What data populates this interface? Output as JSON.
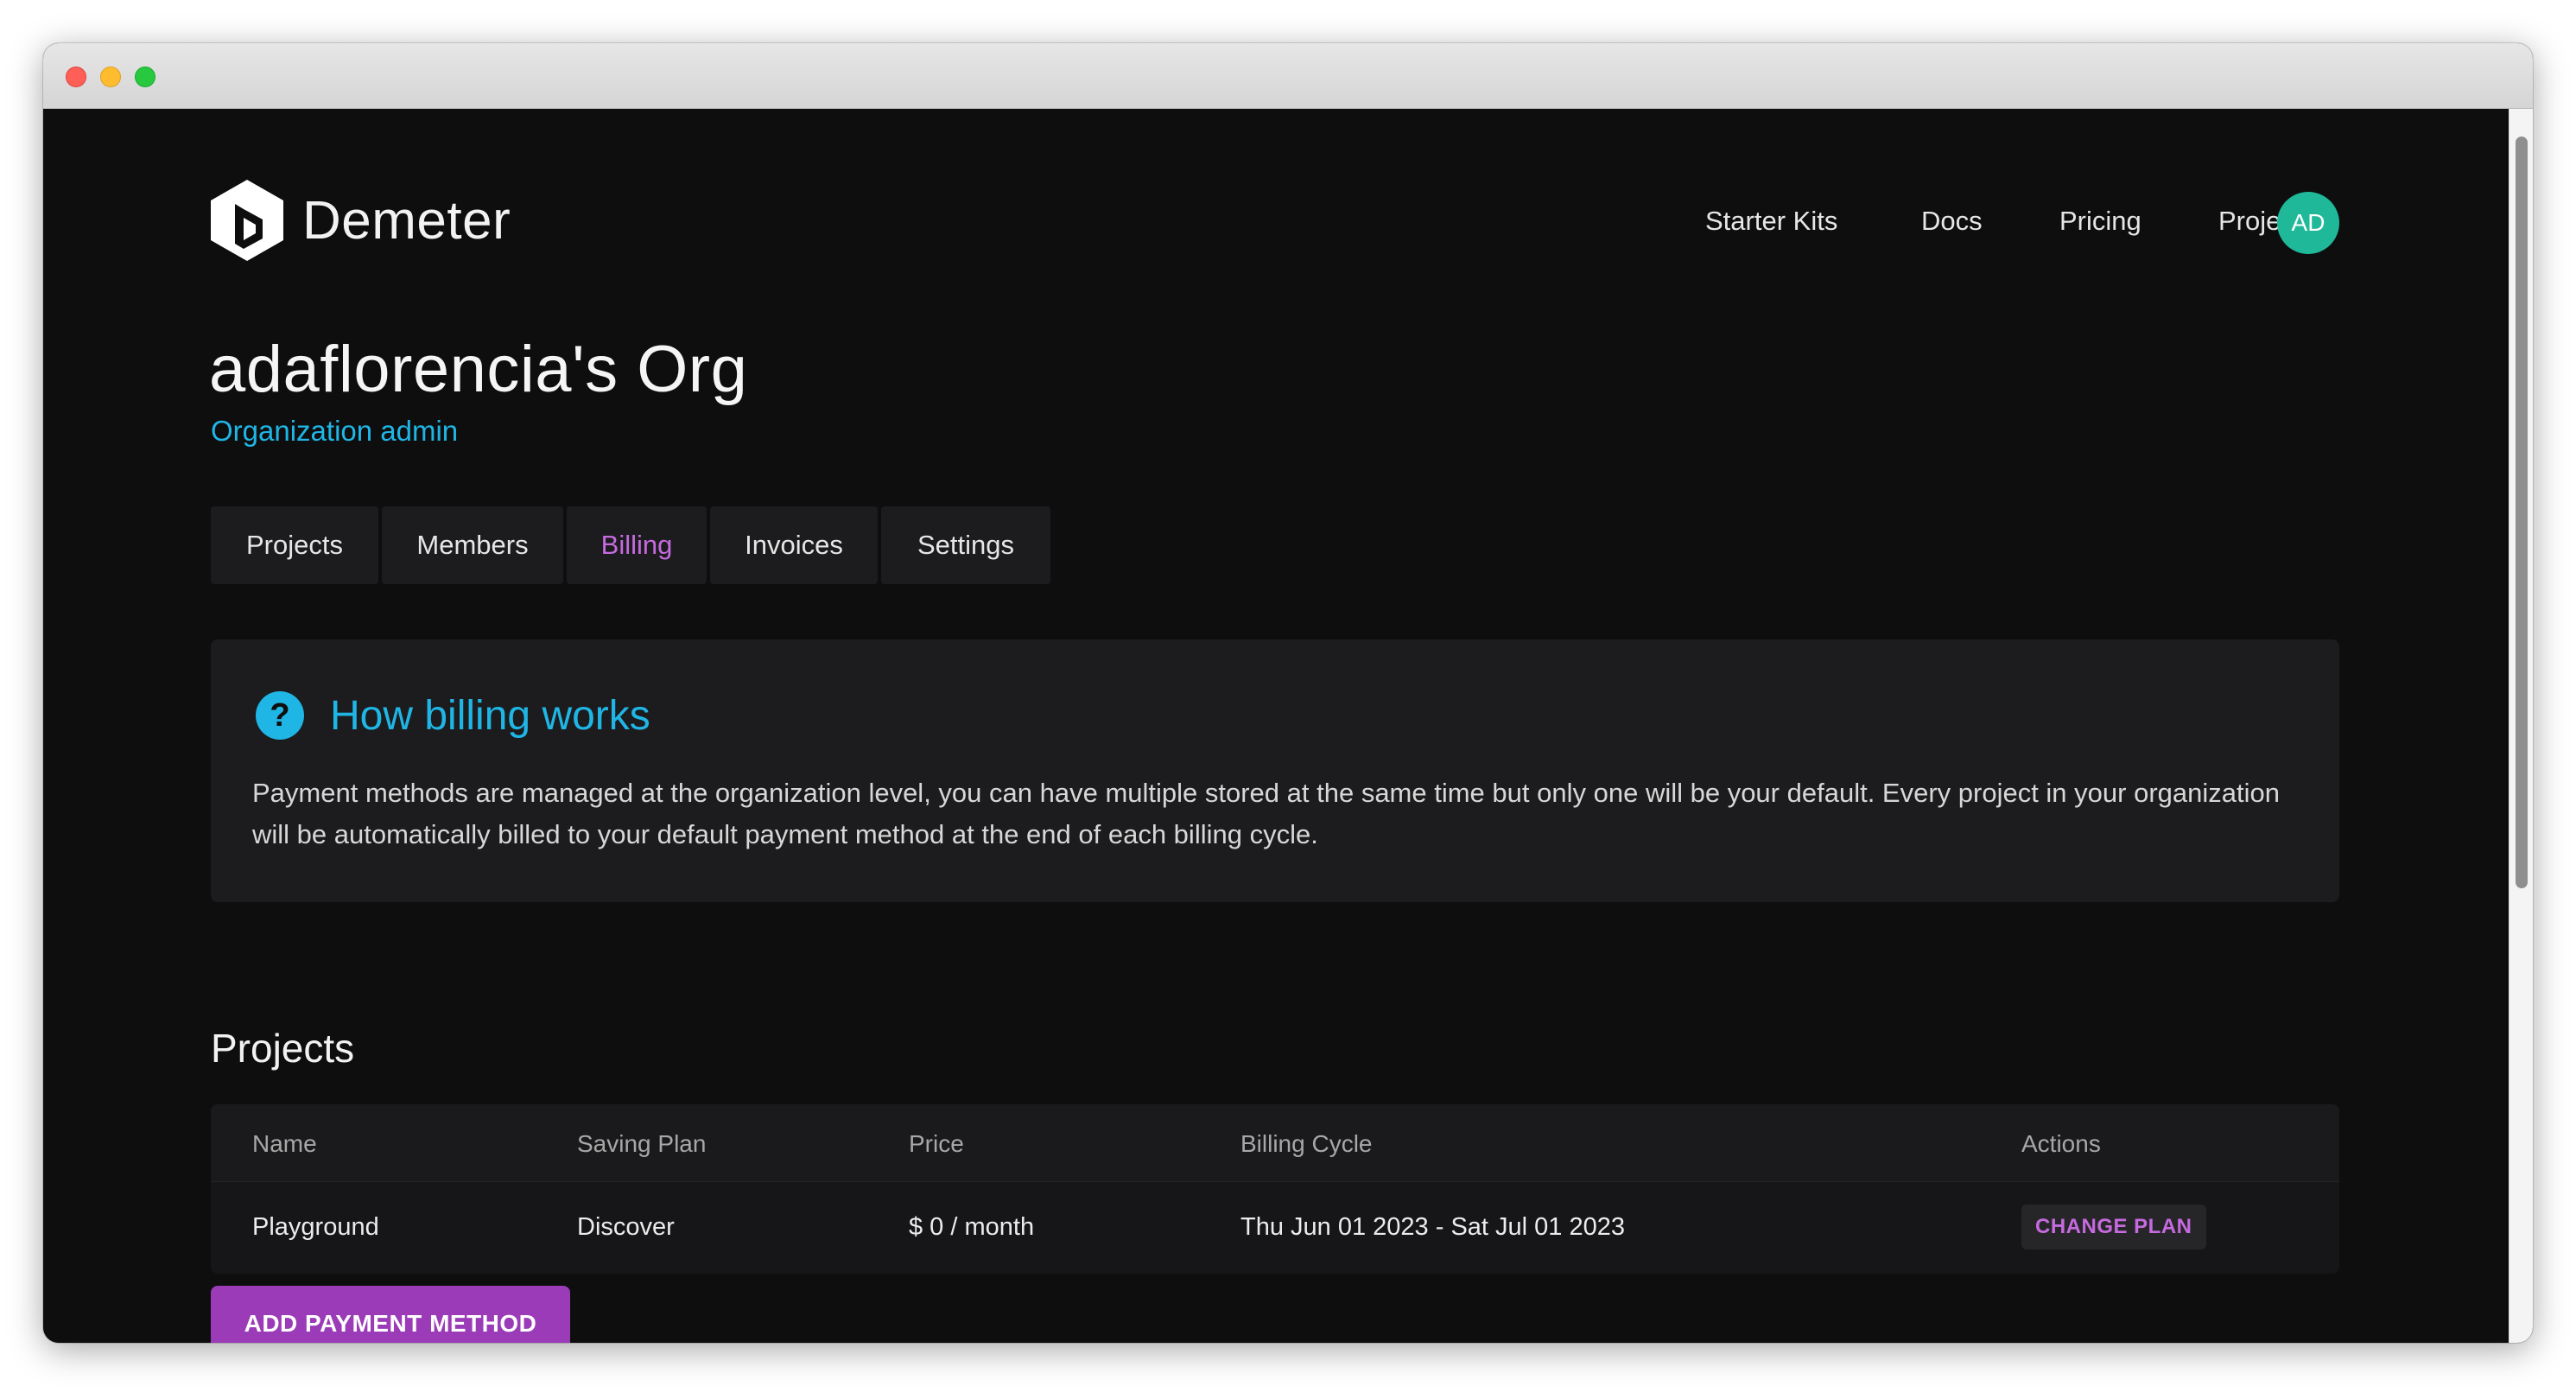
{
  "brand": {
    "name": "Demeter"
  },
  "nav": [
    {
      "label": "Starter Kits"
    },
    {
      "label": "Docs"
    },
    {
      "label": "Pricing"
    },
    {
      "label": "Projects"
    }
  ],
  "user": {
    "initials": "AD",
    "avatar_color": "#1fb99a"
  },
  "org": {
    "title": "adaflorencia's Org",
    "role": "Organization admin"
  },
  "tabs": [
    {
      "label": "Projects"
    },
    {
      "label": "Members"
    },
    {
      "label": "Billing",
      "active": true
    },
    {
      "label": "Invoices"
    },
    {
      "label": "Settings"
    }
  ],
  "info": {
    "icon": "help-icon",
    "title": "How billing works",
    "text": "Payment methods are managed at the organization level, you can have multiple stored at the same time but only one will be your default. Every project in your organization will be automatically billed to your default payment method at the end of each billing cycle."
  },
  "projects": {
    "title": "Projects",
    "columns": [
      "Name",
      "Saving Plan",
      "Price",
      "Billing Cycle",
      "Actions"
    ],
    "rows": [
      {
        "name": "Playground",
        "plan": "Discover",
        "price": "$ 0 / month",
        "cycle": "Thu Jun 01 2023 - Sat Jul 01 2023",
        "action": "CHANGE PLAN"
      }
    ]
  },
  "add_payment_label": "ADD PAYMENT METHOD",
  "colors": {
    "accent": "#1fb6e6",
    "purple": "#c66ae0",
    "button": "#9b3bb8",
    "background": "#0e0e0f"
  }
}
